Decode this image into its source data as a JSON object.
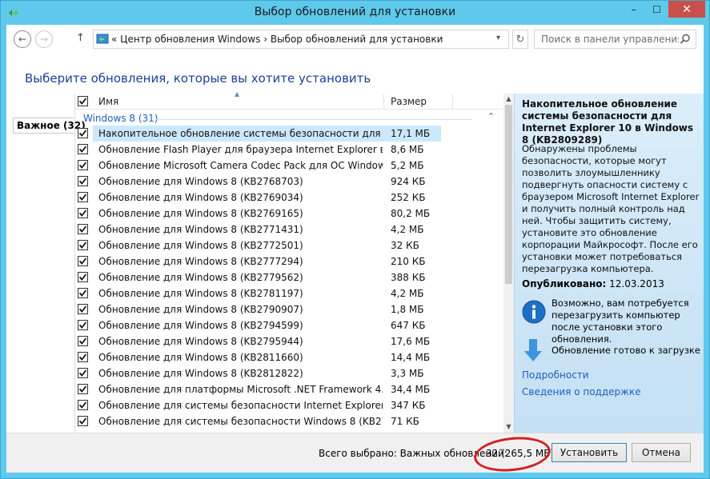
{
  "window": {
    "title": "Выбор обновлений для установки",
    "controls": {
      "minimize": "–",
      "maximize": "☐",
      "close": "✕"
    }
  },
  "address_bar": {
    "path": "«  Центр обновления Windows  ›  Выбор обновлений для установки",
    "search_placeholder": "Поиск в панели управления"
  },
  "page": {
    "heading": "Выберите обновления, которые вы хотите установить"
  },
  "categories": [
    {
      "label": "Важное (32)",
      "selected": true
    }
  ],
  "columns": {
    "name": "Имя",
    "size": "Размер"
  },
  "group": {
    "label": "Windows 8 (31)"
  },
  "updates": [
    {
      "name": "Накопительное обновление системы безопасности для Internet Explorer 10",
      "size": "17,1 МБ",
      "checked": true,
      "selected": true
    },
    {
      "name": "Обновление Flash Player для браузера Internet Explorer в Windows 8",
      "size": "8,6 МБ",
      "checked": true
    },
    {
      "name": "Обновление Microsoft Camera Codec Pack для ОС Windows 8 (KB2779444)",
      "size": "5,2 МБ",
      "checked": true
    },
    {
      "name": "Обновление для Windows 8 (KB2768703)",
      "size": "924 КБ",
      "checked": true
    },
    {
      "name": "Обновление для Windows 8 (KB2769034)",
      "size": "252 КБ",
      "checked": true
    },
    {
      "name": "Обновление для Windows 8 (KB2769165)",
      "size": "80,2 МБ",
      "checked": true
    },
    {
      "name": "Обновление для Windows 8 (KB2771431)",
      "size": "4,2 МБ",
      "checked": true
    },
    {
      "name": "Обновление для Windows 8 (KB2772501)",
      "size": "32 КБ",
      "checked": true
    },
    {
      "name": "Обновление для Windows 8 (KB2777294)",
      "size": "210 КБ",
      "checked": true
    },
    {
      "name": "Обновление для Windows 8 (KB2779562)",
      "size": "388 КБ",
      "checked": true
    },
    {
      "name": "Обновление для Windows 8 (KB2781197)",
      "size": "4,2 МБ",
      "checked": true
    },
    {
      "name": "Обновление для Windows 8 (KB2790907)",
      "size": "1,8 МБ",
      "checked": true
    },
    {
      "name": "Обновление для Windows 8 (KB2794599)",
      "size": "647 КБ",
      "checked": true
    },
    {
      "name": "Обновление для Windows 8 (KB2795944)",
      "size": "17,6 МБ",
      "checked": true
    },
    {
      "name": "Обновление для Windows 8 (KB2811660)",
      "size": "14,4 МБ",
      "checked": true
    },
    {
      "name": "Обновление для Windows 8 (KB2812822)",
      "size": "3,3 МБ",
      "checked": true
    },
    {
      "name": "Обновление для платформы Microsoft .NET Framework 4.5 в Windows 8",
      "size": "34,4 МБ",
      "checked": true
    },
    {
      "name": "Обновление для системы безопасности Internet Explorer 10 в Windows 8",
      "size": "347 КБ",
      "checked": true
    },
    {
      "name": "Обновление для системы безопасности Windows 8 (KB2727528)",
      "size": "71 КБ",
      "checked": true
    }
  ],
  "details": {
    "title": "Накопительное обновление системы безопасности для Internet Explorer 10 в Windows 8 (KB2809289)",
    "description": "Обнаружены проблемы безопасности, которые могут позволить злоумышленнику подвергнуть опасности систему с браузером Microsoft Internet Explorer и получить полный контроль над ней. Чтобы защитить систему, установите это обновление корпорации Майкрософт. После его установки может потребоваться перезагрузка компьютера.",
    "published_label": "Опубликовано:",
    "published_date": "12.03.2013",
    "restart_note": "Возможно, вам потребуется перезагрузить компьютер после установки этого обновления.",
    "download_status": "Обновление готово к загрузке",
    "links": {
      "details": "Подробности",
      "support": "Сведения о поддержке"
    }
  },
  "footer": {
    "total_label": "Всего выбрано: Важных обновлений:",
    "total_value": "32 (265,5 МБ)",
    "install_button": "Установить",
    "cancel_button": "Отмена"
  },
  "colors": {
    "chrome": "#5fc9ec",
    "heading": "#1e3f95",
    "link": "#1e5fbd",
    "selection": "#cce8ff",
    "annotation_circle": "#d41f1f"
  }
}
